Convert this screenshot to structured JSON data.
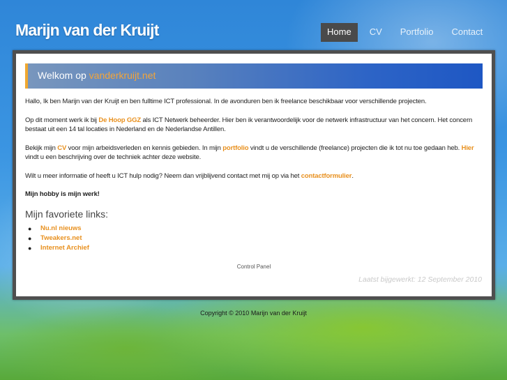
{
  "header": {
    "site_title": "Marijn van der Kruijt"
  },
  "nav": {
    "items": [
      {
        "label": "Home",
        "active": true
      },
      {
        "label": "CV",
        "active": false
      },
      {
        "label": "Portfolio",
        "active": false
      },
      {
        "label": "Contact",
        "active": false
      }
    ]
  },
  "welcome": {
    "prefix": "Welkom op ",
    "domain": "vanderkruijt.net"
  },
  "content": {
    "p1": "Hallo, Ik ben Marijn van der Kruijt en ben fulltime ICT professional. In de avonduren ben ik freelance beschikbaar voor verschillende projecten.",
    "p2_pre": "Op dit moment werk ik bij ",
    "p2_link": "De Hoop GGZ",
    "p2_post": " als ICT Netwerk beheerder. Hier ben ik verantwoordelijk voor de netwerk infrastructuur van het concern. Het concern bestaat uit een 14 tal locaties in Nederland en de Nederlandse Antillen.",
    "p3_a": "Bekijk mijn ",
    "p3_link1": "CV",
    "p3_b": " voor mijn arbeidsverleden en kennis gebieden. In mijn ",
    "p3_link2": "portfolio",
    "p3_c": " vindt u de verschillende (freelance) projecten die ik tot nu toe gedaan heb. ",
    "p3_link3": "Hier",
    "p3_d": " vindt u een beschrijving over de techniek achter deze website.",
    "p4_pre": "Wilt u meer informatie of heeft u ICT hulp nodig? Neem dan vrijblijvend contact met mij op via het ",
    "p4_link": "contactformulier",
    "p4_post": ".",
    "hobby": "Mijn hobby is mijn werk!",
    "links_heading": "Mijn favoriete links:",
    "links": [
      "Nu.nl nieuws",
      "Tweakers.net",
      "Internet Archief"
    ],
    "bullet": "●"
  },
  "footer": {
    "control_panel": "Control Panel",
    "updated": "Laatst bijgewerkt: 12 September 2010",
    "copyright": "Copyright © 2010 Marijn van der Kruijt"
  },
  "colors": {
    "accent": "#e8901e",
    "nav_active_bg": "#4a4a4a",
    "panel_border": "#4f4f4f",
    "welcome_bar": "#2d64c6"
  }
}
